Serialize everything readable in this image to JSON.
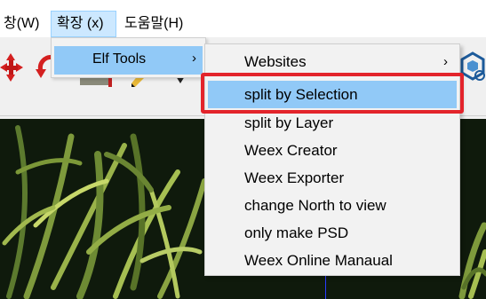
{
  "menubar": {
    "items": [
      {
        "label": "창(W)"
      },
      {
        "label": "확장 (x)"
      },
      {
        "label": "도움말(H)"
      }
    ]
  },
  "submenu_extensions": {
    "items": [
      {
        "label": "Elf Tools",
        "arrow": "›"
      }
    ]
  },
  "submenu_elf_tools": {
    "items": [
      {
        "label": "Websites",
        "arrow": "›"
      },
      {
        "label": "split by Selection"
      },
      {
        "label": "split by Layer"
      },
      {
        "label": "Weex Creator"
      },
      {
        "label": "Weex Exporter"
      },
      {
        "label": "change North to view"
      },
      {
        "label": "only make PSD"
      },
      {
        "label": "Weex Online Manaual"
      }
    ],
    "highlighted": "split by Selection"
  },
  "colors": {
    "highlight": "#91c9f7",
    "menu_active": "#cce8ff",
    "annotation_box": "#e3242b"
  },
  "toolbar": {
    "icons": [
      "move-icon",
      "rotate-icon",
      "paint-bucket-icon",
      "pencil-icon",
      "extension-cube-icon"
    ]
  }
}
